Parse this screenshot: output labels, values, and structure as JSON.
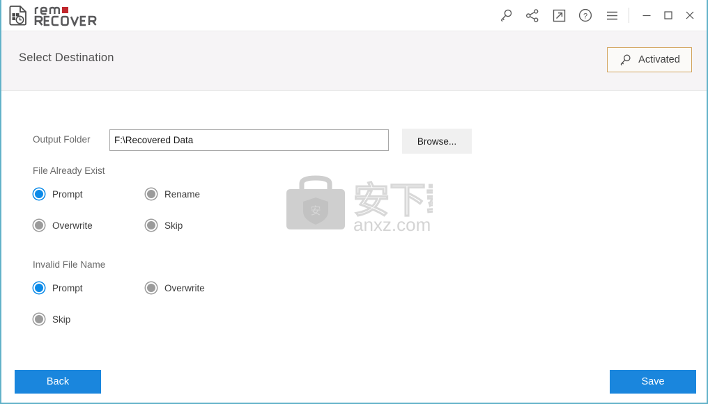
{
  "app": {
    "logo_primary": "remo",
    "logo_secondary": "RECOVER",
    "accent_border": "#63b2c9",
    "logo_dot_color": "#c0272d"
  },
  "titlebar": {
    "icons": [
      {
        "name": "key-icon",
        "label": "Activate / Key"
      },
      {
        "name": "share-icon",
        "label": "Share"
      },
      {
        "name": "external-link-icon",
        "label": "Open link"
      },
      {
        "name": "help-icon",
        "label": "Help"
      },
      {
        "name": "hamburger-menu-icon",
        "label": "Menu"
      }
    ],
    "window_controls": [
      {
        "name": "minimize-button",
        "label": "Minimize"
      },
      {
        "name": "maximize-button",
        "label": "Maximize"
      },
      {
        "name": "close-button",
        "label": "Close"
      }
    ]
  },
  "header": {
    "title": "Select Destination",
    "activated_label": "Activated",
    "activated_border_color": "#d2a45c"
  },
  "form": {
    "output_folder_label": "Output Folder",
    "output_folder_value": "F:\\Recovered Data",
    "output_folder_placeholder": "",
    "browse_label": "Browse..."
  },
  "file_already_exist": {
    "title": "File Already Exist",
    "options": [
      {
        "label": "Prompt",
        "selected": true
      },
      {
        "label": "Rename",
        "selected": false
      },
      {
        "label": "Overwrite",
        "selected": false
      },
      {
        "label": "Skip",
        "selected": false
      }
    ]
  },
  "invalid_file_name": {
    "title": "Invalid File Name",
    "options": [
      {
        "label": "Prompt",
        "selected": true
      },
      {
        "label": "Overwrite",
        "selected": false
      },
      {
        "label": "Skip",
        "selected": false
      }
    ]
  },
  "watermark": {
    "cjk_text": "安下载",
    "domain_text": "anxz.com",
    "shield_glyph": "安"
  },
  "footer": {
    "back_label": "Back",
    "save_label": "Save",
    "button_color": "#1a86dd"
  }
}
